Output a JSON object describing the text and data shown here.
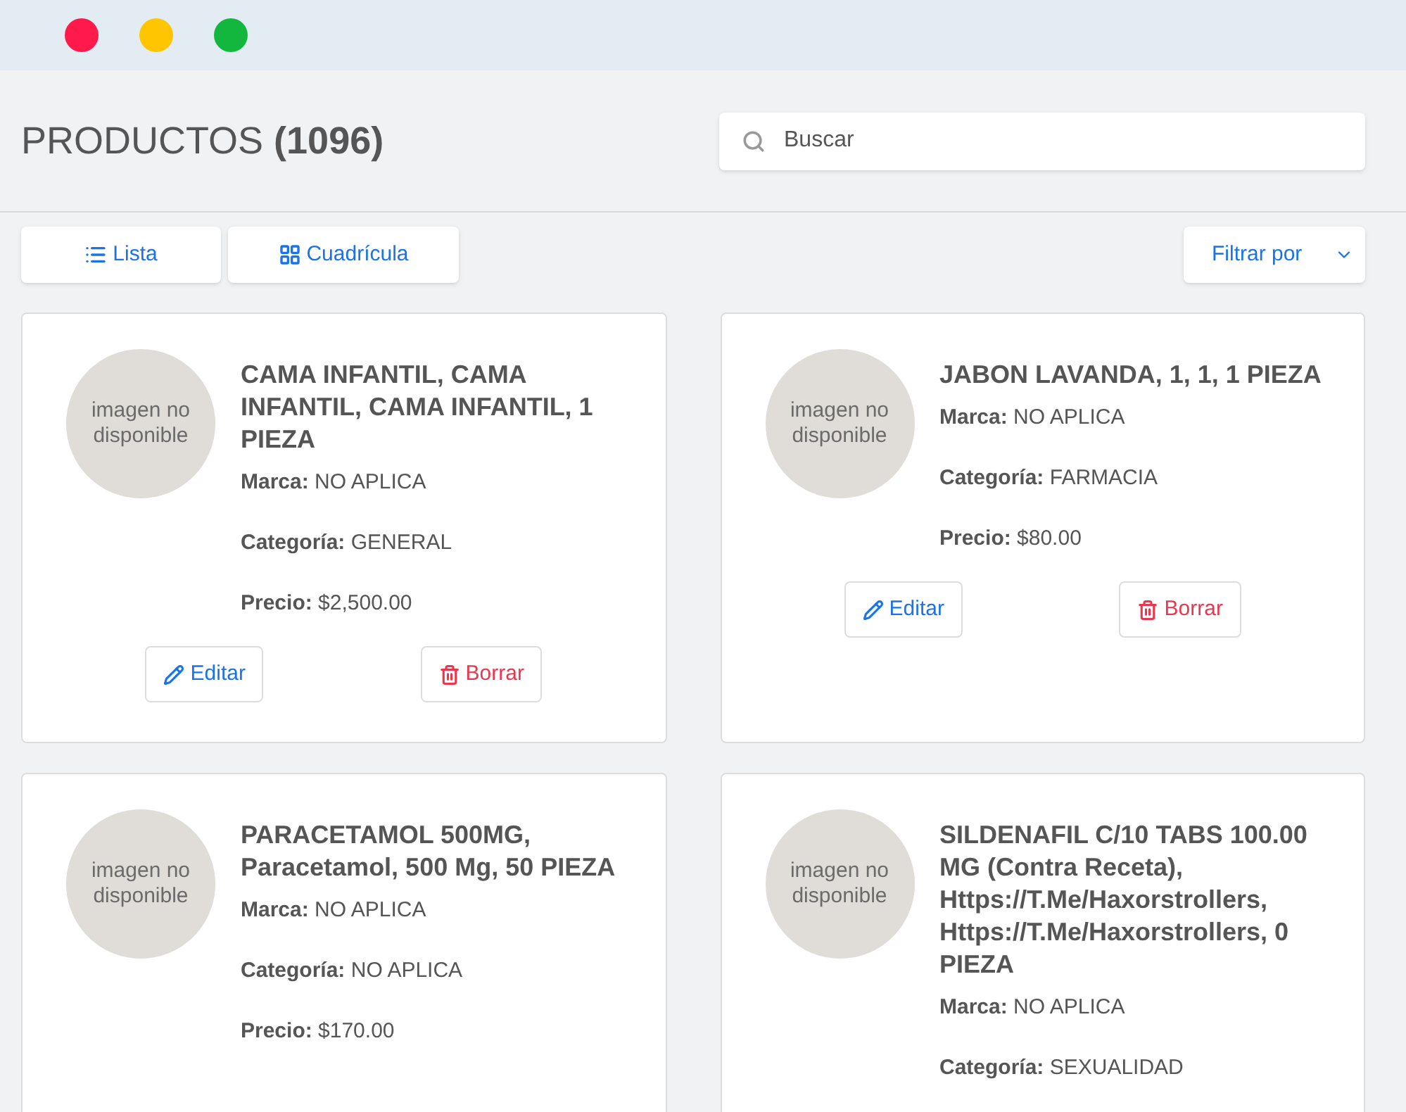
{
  "window_controls": [
    {
      "color": "#ff1a4b"
    },
    {
      "color": "#ffc500"
    },
    {
      "color": "#13b73d"
    }
  ],
  "header": {
    "title": "PRODUCTOS",
    "count": "(1096)"
  },
  "search": {
    "placeholder": "Buscar"
  },
  "view_toggle": [
    {
      "kind": "list",
      "label": "Lista"
    },
    {
      "kind": "grid",
      "label": "Cuadrícula"
    }
  ],
  "filter": {
    "label": "Filtrar por"
  },
  "products": [
    {
      "image_text": "imagen no disponible",
      "name": "CAMA INFANTIL, CAMA INFANTIL, CAMA INFANTIL, 1 PIEZA",
      "fields": [
        {
          "label": "Marca:",
          "value": "NO APLICA"
        },
        {
          "label": "Categoría:",
          "value": "GENERAL"
        },
        {
          "label": "Precio:",
          "value": "$2,500.00"
        }
      ],
      "actions": [
        {
          "kind": "edit",
          "label": "Editar"
        },
        {
          "kind": "delete",
          "label": "Borrar"
        }
      ]
    },
    {
      "image_text": "imagen no disponible",
      "name": "JABON LAVANDA, 1, 1, 1 PIEZA",
      "fields": [
        {
          "label": "Marca:",
          "value": "NO APLICA"
        },
        {
          "label": "Categoría:",
          "value": "FARMACIA"
        },
        {
          "label": "Precio:",
          "value": "$80.00"
        }
      ],
      "actions": [
        {
          "kind": "edit",
          "label": "Editar"
        },
        {
          "kind": "delete",
          "label": "Borrar"
        }
      ]
    },
    {
      "image_text": "imagen no disponible",
      "name": "PARACETAMOL 500MG, Paracetamol, 500 Mg, 50 PIEZA",
      "fields": [
        {
          "label": "Marca:",
          "value": "NO APLICA"
        },
        {
          "label": "Categoría:",
          "value": "NO APLICA"
        },
        {
          "label": "Precio:",
          "value": "$170.00"
        }
      ]
    },
    {
      "image_text": "imagen no disponible",
      "name": "SILDENAFIL C/10 TABS 100.00 MG (Contra Receta), Https://T.Me/Haxorstrollers, Https://T.Me/Haxorstrollers, 0 PIEZA",
      "fields": [
        {
          "label": "Marca:",
          "value": "NO APLICA"
        },
        {
          "label": "Categoría:",
          "value": "SEXUALIDAD"
        }
      ]
    }
  ]
}
